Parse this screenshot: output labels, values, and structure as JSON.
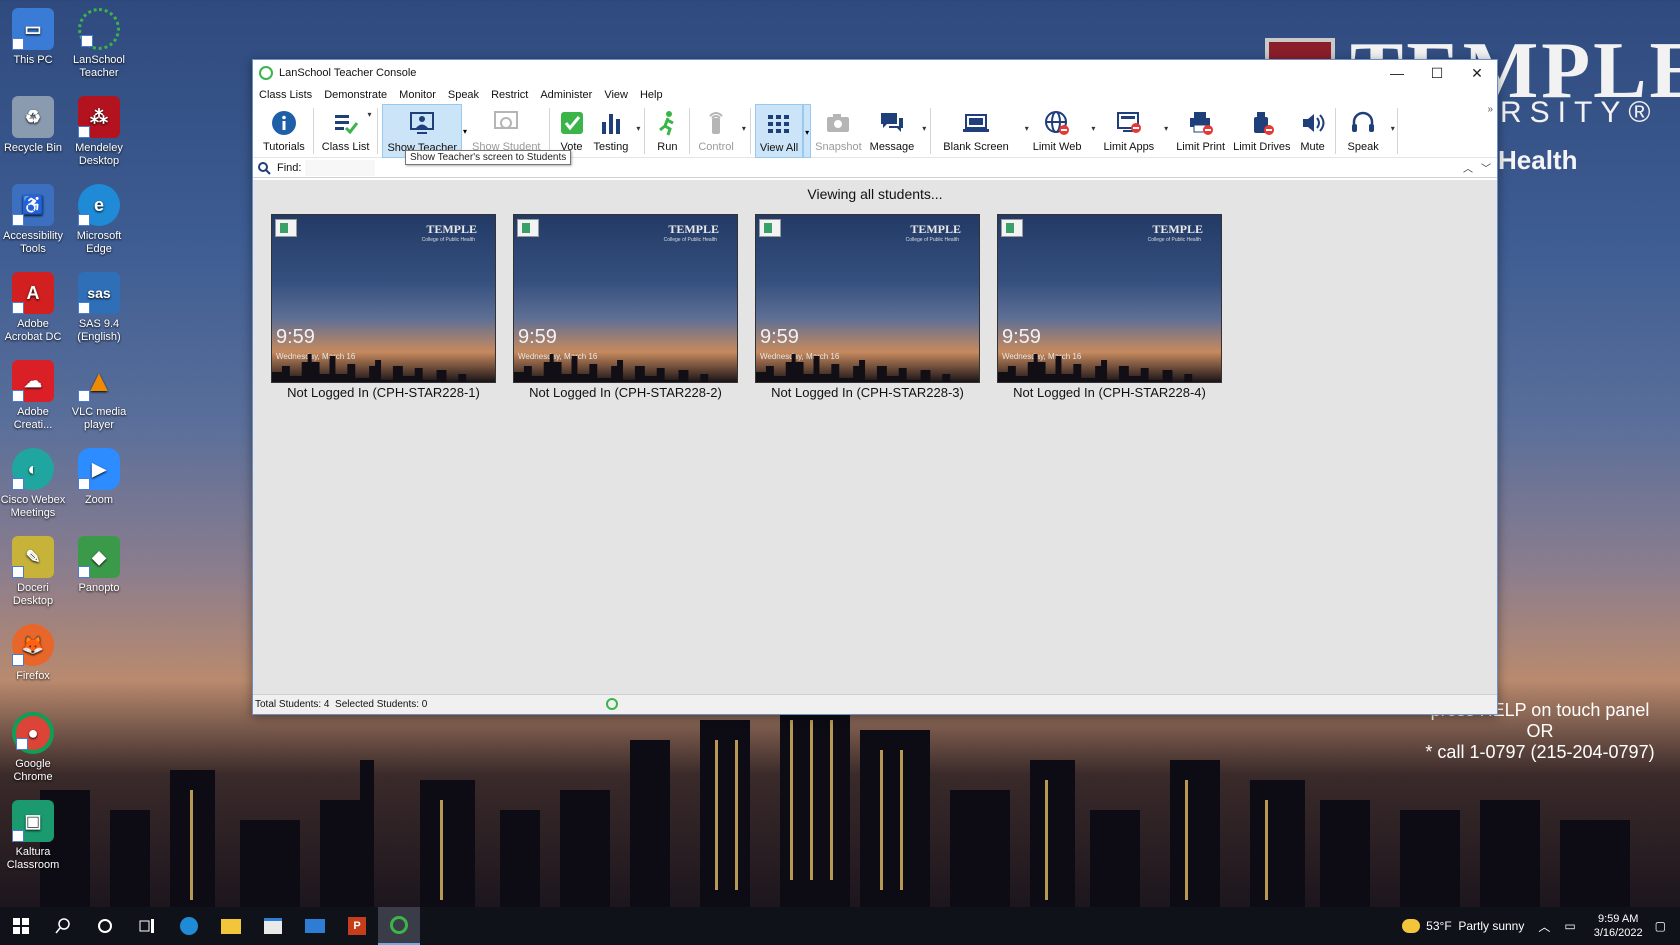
{
  "wallpaper": {
    "title": "TEMPLE",
    "subtitle": "RSITY®",
    "health": "Health",
    "help_line1": "press HELP on touch panel",
    "help_line2": "OR",
    "help_line3": "* call 1-0797 (215-204-0797)"
  },
  "desktop_icons": [
    {
      "label": "This PC",
      "icon": "computer-icon",
      "color": "#3a7bd5"
    },
    {
      "label": "LanSchool Teacher",
      "icon": "lanschool-icon",
      "color": "#2b8a3e"
    },
    {
      "label": "Recycle Bin",
      "icon": "recycle-bin-icon",
      "color": "#8a9bb0"
    },
    {
      "label": "Mendeley Desktop",
      "icon": "mendeley-icon",
      "color": "#b3121f"
    },
    {
      "label": "Accessibility Tools",
      "icon": "accessibility-icon",
      "color": "#3c6fc0"
    },
    {
      "label": "Microsoft Edge",
      "icon": "edge-icon",
      "color": "#1f8ad6"
    },
    {
      "label": "Adobe Acrobat DC",
      "icon": "acrobat-icon",
      "color": "#d21f1f"
    },
    {
      "label": "SAS 9.4 (English)",
      "icon": "sas-icon",
      "color": "#2f6fb8"
    },
    {
      "label": "Adobe Creati...",
      "icon": "creative-cloud-icon",
      "color": "#da1f26"
    },
    {
      "label": "VLC media player",
      "icon": "vlc-icon",
      "color": "#f08a00"
    },
    {
      "label": "Cisco Webex Meetings",
      "icon": "webex-icon",
      "color": "#1fa6a0"
    },
    {
      "label": "Zoom",
      "icon": "zoom-icon",
      "color": "#2d8cff"
    },
    {
      "label": "Doceri Desktop",
      "icon": "doceri-icon",
      "color": "#c7b33a"
    },
    {
      "label": "Panopto",
      "icon": "panopto-icon",
      "color": "#3a9a4a"
    },
    {
      "label": "Firefox",
      "icon": "firefox-icon",
      "color": "#e8662a"
    },
    {
      "label": "Google Chrome",
      "icon": "chrome-icon",
      "color": "#db4437"
    },
    {
      "label": "Kaltura Classroom",
      "icon": "kaltura-icon",
      "color": "#1a9a6e"
    }
  ],
  "window": {
    "title": "LanSchool Teacher Console",
    "minimize": "—",
    "maximize": "☐",
    "close": "✕"
  },
  "menu": [
    "Class Lists",
    "Demonstrate",
    "Monitor",
    "Speak",
    "Restrict",
    "Administer",
    "View",
    "Help"
  ],
  "toolbar": {
    "tutorials": "Tutorials",
    "class_list": "Class List",
    "show_teacher": "Show Teacher",
    "show_student": "Show Student",
    "vote": "Vote",
    "testing": "Testing",
    "run": "Run",
    "control": "Control",
    "view_all": "View All",
    "snapshot": "Snapshot",
    "message": "Message",
    "blank_screen": "Blank Screen",
    "limit_web": "Limit Web",
    "limit_apps": "Limit Apps",
    "limit_print": "Limit Print",
    "limit_drives": "Limit Drives",
    "mute": "Mute",
    "speak": "Speak",
    "overflow": "»"
  },
  "tooltip": "Show Teacher's screen to Students",
  "find": {
    "label": "Find:",
    "value": ""
  },
  "viewing_text": "Viewing all students...",
  "students": [
    {
      "name": "Not Logged In (CPH-STAR228-1)",
      "time": "9:59",
      "date": "Wednesday, March 16",
      "logo": "TEMPLE",
      "logo_sub": "College of Public Health"
    },
    {
      "name": "Not Logged In (CPH-STAR228-2)",
      "time": "9:59",
      "date": "Wednesday, March 16",
      "logo": "TEMPLE",
      "logo_sub": "College of Public Health"
    },
    {
      "name": "Not Logged In (CPH-STAR228-3)",
      "time": "9:59",
      "date": "Wednesday, March 16",
      "logo": "TEMPLE",
      "logo_sub": "College of Public Health"
    },
    {
      "name": "Not Logged In (CPH-STAR228-4)",
      "time": "9:59",
      "date": "Wednesday, March 16",
      "logo": "TEMPLE",
      "logo_sub": "College of Public Health"
    }
  ],
  "status": {
    "text": "Total Students: 4  Selected Students: 0"
  },
  "taskbar": {
    "weather": "53°F  Partly sunny",
    "time": "9:59 AM",
    "date": "3/16/2022"
  }
}
